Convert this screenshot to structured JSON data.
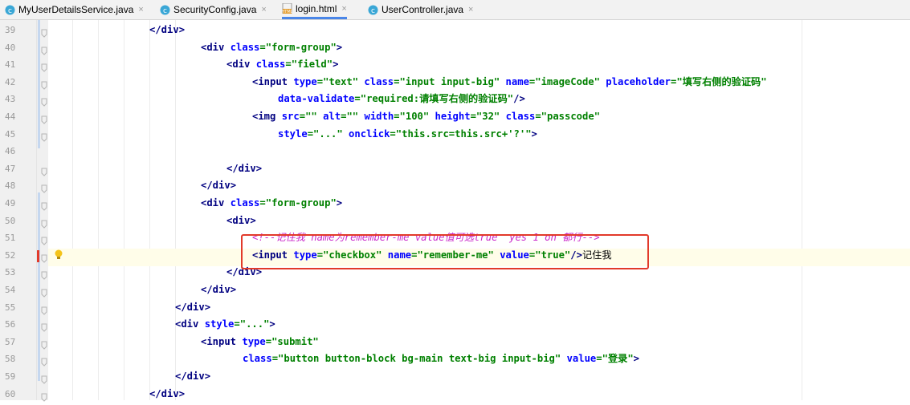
{
  "tabs": [
    {
      "label": "MyUserDetailsService.java",
      "icon": "java-class-icon",
      "active": false
    },
    {
      "label": "SecurityConfig.java",
      "icon": "java-class-icon",
      "active": false
    },
    {
      "label": "login.html",
      "icon": "html-file-icon",
      "active": true
    },
    {
      "label": "UserController.java",
      "icon": "java-class-icon",
      "active": false
    }
  ],
  "close_glyph": "×",
  "editor": {
    "current_line": "52",
    "lines": [
      {
        "num": "39",
        "text": "</div>"
      },
      {
        "num": "40",
        "text": "<div class=\"form-group\">"
      },
      {
        "num": "41",
        "text": "<div class=\"field\">"
      },
      {
        "num": "42",
        "text": "<input type=\"text\" class=\"input input-big\" name=\"imageCode\" placeholder=\"填写右侧的验证码\""
      },
      {
        "num": "43",
        "text": "data-validate=\"required:请填写右侧的验证码\"/>"
      },
      {
        "num": "44",
        "text": "<img src=\"\" alt=\"\" width=\"100\" height=\"32\" class=\"passcode\""
      },
      {
        "num": "45",
        "text": "style=\"...\" onclick=\"this.src=this.src+'?'\">"
      },
      {
        "num": "46",
        "text": ""
      },
      {
        "num": "47",
        "text": "</div>"
      },
      {
        "num": "48",
        "text": "</div>"
      },
      {
        "num": "49",
        "text": "<div class=\"form-group\">"
      },
      {
        "num": "50",
        "text": "<div>"
      },
      {
        "num": "51",
        "text": "<!--记住我 name为remember-me value值可选true  yes 1 on 都行-->"
      },
      {
        "num": "52",
        "text": "<input type=\"checkbox\" name=\"remember-me\" value=\"true\"/>记住我"
      },
      {
        "num": "53",
        "text": "</div>"
      },
      {
        "num": "54",
        "text": "</div>"
      },
      {
        "num": "55",
        "text": "</div>"
      },
      {
        "num": "56",
        "text": "<div style=\"...\">"
      },
      {
        "num": "57",
        "text": "<input type=\"submit\""
      },
      {
        "num": "58",
        "text": "class=\"button button-block bg-main text-big input-big\" value=\"登录\">"
      },
      {
        "num": "59",
        "text": "</div>"
      },
      {
        "num": "60",
        "text": "</div>"
      }
    ]
  }
}
